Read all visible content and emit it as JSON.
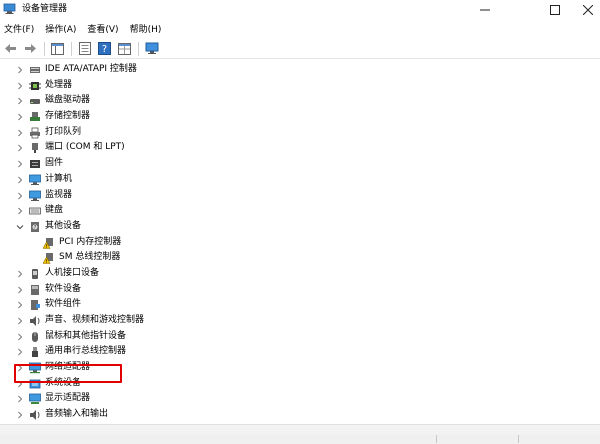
{
  "window": {
    "title": "设备管理器"
  },
  "menu": [
    "文件(F)",
    "操作(A)",
    "查看(V)",
    "帮助(H)"
  ],
  "tree": [
    {
      "label": "IDE ATA/ATAPI 控制器",
      "icon": "ide-controller-icon",
      "expanded": false,
      "child": false
    },
    {
      "label": "处理器",
      "icon": "processor-icon",
      "expanded": false,
      "child": false
    },
    {
      "label": "磁盘驱动器",
      "icon": "disk-drive-icon",
      "expanded": false,
      "child": false
    },
    {
      "label": "存储控制器",
      "icon": "storage-controller-icon",
      "expanded": false,
      "child": false
    },
    {
      "label": "打印队列",
      "icon": "printer-icon",
      "expanded": false,
      "child": false
    },
    {
      "label": "端口 (COM 和 LPT)",
      "icon": "port-icon",
      "expanded": false,
      "child": false
    },
    {
      "label": "固件",
      "icon": "firmware-icon",
      "expanded": false,
      "child": false
    },
    {
      "label": "计算机",
      "icon": "computer-icon",
      "expanded": false,
      "child": false
    },
    {
      "label": "监视器",
      "icon": "monitor-icon",
      "expanded": false,
      "child": false
    },
    {
      "label": "键盘",
      "icon": "keyboard-icon",
      "expanded": false,
      "child": false
    },
    {
      "label": "其他设备",
      "icon": "other-devices-icon",
      "expanded": true,
      "child": false
    },
    {
      "label": "PCI 内存控制器",
      "icon": "warning-device-icon",
      "expanded": false,
      "child": true
    },
    {
      "label": "SM 总线控制器",
      "icon": "warning-device-icon",
      "expanded": false,
      "child": true
    },
    {
      "label": "人机接口设备",
      "icon": "hid-icon",
      "expanded": false,
      "child": false
    },
    {
      "label": "软件设备",
      "icon": "software-device-icon",
      "expanded": false,
      "child": false
    },
    {
      "label": "软件组件",
      "icon": "software-component-icon",
      "expanded": false,
      "child": false
    },
    {
      "label": "声音、视频和游戏控制器",
      "icon": "sound-icon",
      "expanded": false,
      "child": false
    },
    {
      "label": "鼠标和其他指针设备",
      "icon": "mouse-icon",
      "expanded": false,
      "child": false
    },
    {
      "label": "通用串行总线控制器",
      "icon": "usb-icon",
      "expanded": false,
      "child": false
    },
    {
      "label": "网络适配器",
      "icon": "network-adapter-icon",
      "expanded": false,
      "child": false
    },
    {
      "label": "系统设备",
      "icon": "system-device-icon",
      "expanded": false,
      "child": false
    },
    {
      "label": "显示适配器",
      "icon": "display-adapter-icon",
      "expanded": false,
      "child": false
    },
    {
      "label": "音频输入和输出",
      "icon": "audio-io-icon",
      "expanded": false,
      "child": false
    }
  ],
  "colors": {
    "highlight": "#e00000",
    "icon_blue": "#2a7bc8",
    "warning_yellow": "#f2c200"
  }
}
